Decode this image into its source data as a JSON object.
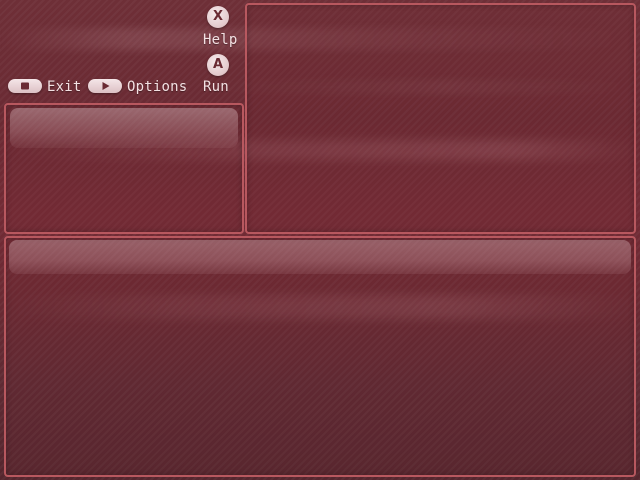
{
  "controls": {
    "help": {
      "glyph": "X",
      "label": "Help",
      "icon": "x-button-icon"
    },
    "run": {
      "glyph": "A",
      "label": "Run",
      "icon": "a-button-icon"
    },
    "exit": {
      "label": "Exit",
      "icon": "select-button-icon"
    },
    "options": {
      "label": "Options",
      "icon": "start-button-icon"
    }
  },
  "colors": {
    "background": "#6e2f37",
    "panel_border": "#b8585f",
    "text": "#f3e1e3"
  }
}
